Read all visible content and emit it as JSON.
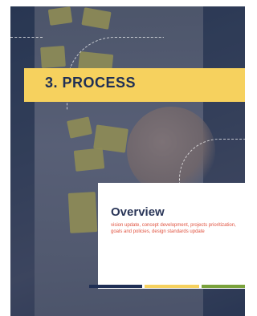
{
  "section": {
    "title": "3. PROCESS"
  },
  "overview": {
    "heading": "Overview",
    "description": "vision update, concept development, projects prioritization, goals and policies, design standards update"
  },
  "colors": {
    "navy": "#1f2f55",
    "yellow": "#f6d15e",
    "green": "#7aa23c",
    "accent_red": "#e0523f",
    "white": "#ffffff"
  }
}
